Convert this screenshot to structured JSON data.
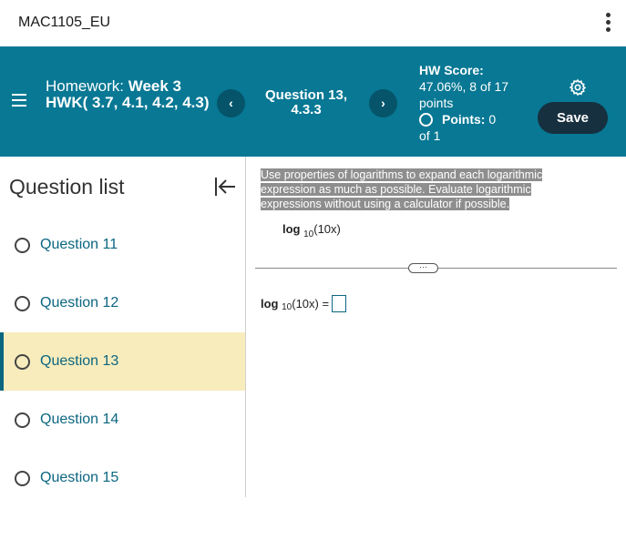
{
  "course": {
    "name": "MAC1105_EU"
  },
  "header": {
    "homework_prefix": "Homework:",
    "homework_name": "Week 3 HWK( 3.7, 4.1, 4.2, 4.3)",
    "question_label": "Question 13, 4.3.3",
    "prev_symbol": "‹",
    "next_symbol": "›",
    "score_label": "HW Score:",
    "score_value": "47.06%, 8 of 17 points",
    "points_label": "Points:",
    "points_value": "0",
    "points_of": "of 1",
    "save_label": "Save"
  },
  "sidebar": {
    "title": "Question list",
    "items": [
      {
        "label": "Question 11"
      },
      {
        "label": "Question 12"
      },
      {
        "label": "Question 13"
      },
      {
        "label": "Question 14"
      },
      {
        "label": "Question 15"
      }
    ],
    "active_index": 2
  },
  "question": {
    "instructions": "Use properties of logarithms to expand each logarithmic expression as much as possible.  Evaluate logarithmic expressions without using a calculator if possible.",
    "log_word": "log",
    "log_base": "10",
    "log_arg": "(10x)",
    "equals": "=",
    "more_label": "···"
  },
  "colors": {
    "header_bg": "#087894",
    "nav_btn_bg": "#05546a",
    "save_bg": "#16303f",
    "active_item_bg": "#f8ecbd",
    "link": "#0b6680"
  },
  "icons": [
    "kebab-menu-icon",
    "hamburger-menu-icon",
    "chevron-left-icon",
    "chevron-right-icon",
    "gear-icon",
    "collapse-panel-icon",
    "radio-circle-icon"
  ]
}
